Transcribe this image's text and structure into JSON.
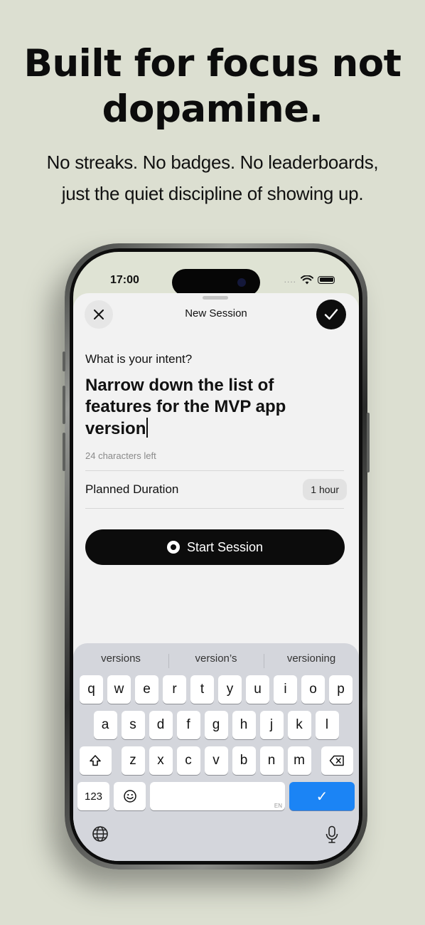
{
  "headline": "Built for focus not dopamine.",
  "subline_1": "No streaks. No badges. No leaderboards,",
  "subline_2": "just the quiet discipline of showing up.",
  "status": {
    "time": "17:00",
    "dots": "...."
  },
  "sheet": {
    "title": "New Session",
    "prompt": "What is your intent?",
    "intent_text": "Narrow down the list of features for the MVP app version",
    "chars_left": "24 characters left",
    "duration_label": "Planned Duration",
    "duration_value": "1 hour",
    "start_label": "Start Session"
  },
  "keyboard": {
    "suggestions": [
      "versions",
      "version’s",
      "versioning"
    ],
    "row1": [
      "q",
      "w",
      "e",
      "r",
      "t",
      "y",
      "u",
      "i",
      "o",
      "p"
    ],
    "row2": [
      "a",
      "s",
      "d",
      "f",
      "g",
      "h",
      "j",
      "k",
      "l"
    ],
    "row3": [
      "z",
      "x",
      "c",
      "v",
      "b",
      "n",
      "m"
    ],
    "numbers_key": "123",
    "space_locale": "EN",
    "return_key": "✓"
  },
  "icons": [
    "close-icon",
    "checkmark-icon",
    "record-icon",
    "shift-icon",
    "delete-icon",
    "emoji-icon",
    "globe-icon",
    "microphone-icon",
    "wifi-icon",
    "battery-icon"
  ],
  "colors": {
    "background": "#dcdfd1",
    "primary": "#0c0c0c",
    "return_key": "#1b84f5"
  }
}
